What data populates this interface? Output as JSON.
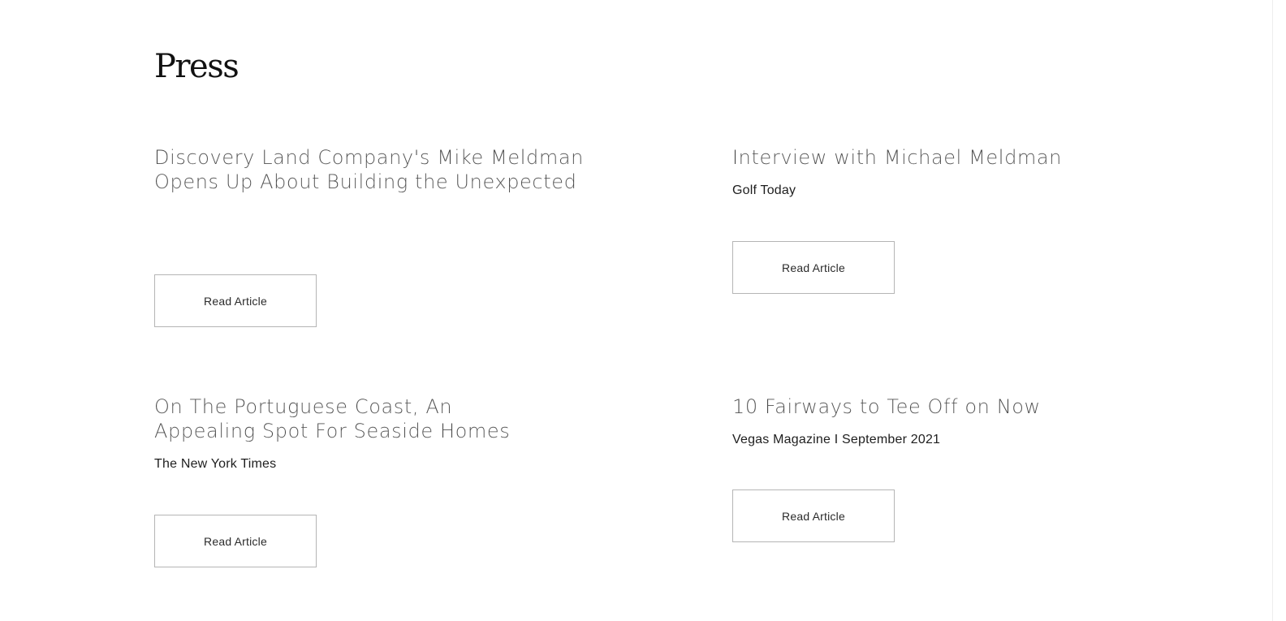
{
  "page": {
    "title": "Press"
  },
  "articles": [
    {
      "title": "Discovery Land Company's Mike Meldman Opens Up About Building the Unexpected",
      "source": "",
      "button_label": "Read Article"
    },
    {
      "title": "Interview with Michael Meldman",
      "source": "Golf Today",
      "button_label": "Read Article"
    },
    {
      "title": "On The Portuguese Coast, An Appealing Spot For Seaside Homes",
      "source": "The New York Times",
      "button_label": "Read Article"
    },
    {
      "title": "10 Fairways to Tee Off on Now",
      "source": "Vegas Magazine I September 2021",
      "button_label": "Read Article"
    }
  ]
}
